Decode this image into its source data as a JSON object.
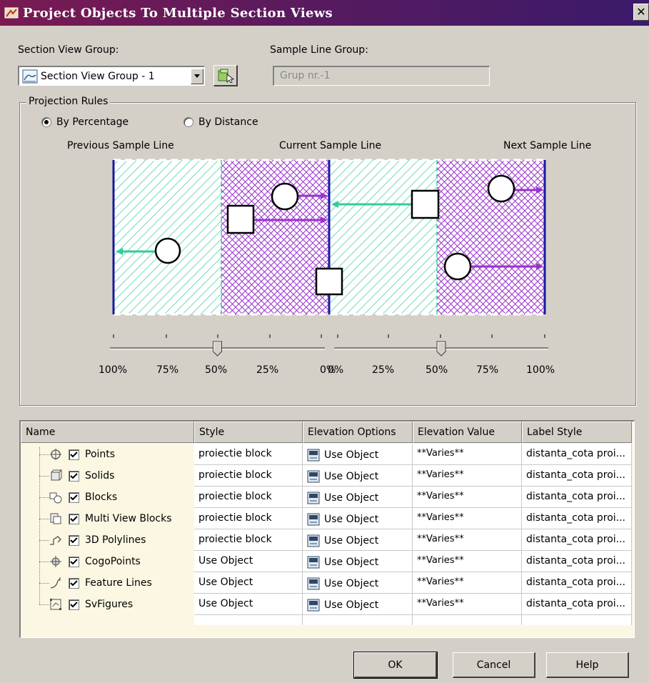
{
  "window": {
    "title": "Project Objects To Multiple Section Views",
    "close_glyph": "✕"
  },
  "section_view_group": {
    "label": "Section View Group:",
    "value": "Section View Group - 1"
  },
  "sample_line_group": {
    "label": "Sample Line Group:",
    "value": "Grup nr.-1"
  },
  "projection_rules": {
    "legend": "Projection Rules",
    "options": [
      {
        "label": "By Percentage",
        "selected": true
      },
      {
        "label": "By Distance",
        "selected": false
      }
    ],
    "lines": {
      "previous": "Previous Sample Line",
      "current": "Current Sample Line",
      "next": "Next Sample Line"
    },
    "left_slider": {
      "ticks": [
        "100%",
        "75%",
        "50%",
        "25%",
        "0%"
      ],
      "value_percent": 50
    },
    "right_slider": {
      "ticks": [
        "0%",
        "25%",
        "50%",
        "75%",
        "100%"
      ],
      "value_percent": 50
    }
  },
  "table": {
    "columns": [
      "Name",
      "Style",
      "Elevation Options",
      "Elevation Value",
      "Label Style"
    ],
    "rows": [
      {
        "icon": "point-icon",
        "checked": true,
        "name": "Points",
        "style": "proiectie block",
        "elevation_option": "Use Object",
        "elevation_value": "**Varies**",
        "label_style": "distanta_cota proi..."
      },
      {
        "icon": "solid-icon",
        "checked": true,
        "name": "Solids",
        "style": "proiectie block",
        "elevation_option": "Use Object",
        "elevation_value": "**Varies**",
        "label_style": "distanta_cota proi..."
      },
      {
        "icon": "block-icon",
        "checked": true,
        "name": "Blocks",
        "style": "proiectie block",
        "elevation_option": "Use Object",
        "elevation_value": "**Varies**",
        "label_style": "distanta_cota proi..."
      },
      {
        "icon": "multiview-block-icon",
        "checked": true,
        "name": "Multi View Blocks",
        "style": "proiectie block",
        "elevation_option": "Use Object",
        "elevation_value": "**Varies**",
        "label_style": "distanta_cota proi..."
      },
      {
        "icon": "3d-polyline-icon",
        "checked": true,
        "name": "3D Polylines",
        "style": "proiectie block",
        "elevation_option": "Use Object",
        "elevation_value": "**Varies**",
        "label_style": "distanta_cota proi..."
      },
      {
        "icon": "cogo-point-icon",
        "checked": true,
        "name": "CogoPoints",
        "style": "Use Object",
        "elevation_option": "Use Object",
        "elevation_value": "**Varies**",
        "label_style": "distanta_cota proi..."
      },
      {
        "icon": "feature-line-icon",
        "checked": true,
        "name": "Feature Lines",
        "style": "Use Object",
        "elevation_option": "Use Object",
        "elevation_value": "**Varies**",
        "label_style": "distanta_cota proi..."
      },
      {
        "icon": "sv-figure-icon",
        "checked": true,
        "name": "SvFigures",
        "style": "Use Object",
        "elevation_option": "Use Object",
        "elevation_value": "**Varies**",
        "label_style": "distanta_cota proi..."
      }
    ]
  },
  "buttons": {
    "ok": "OK",
    "cancel": "Cancel",
    "help": "Help"
  },
  "colors": {
    "title_start": "#7a1a52",
    "title_end": "#3a1a6a",
    "hatch_green": "#33cc99",
    "hatch_purple": "#9933cc",
    "sample_line": "#1a1aa0"
  }
}
